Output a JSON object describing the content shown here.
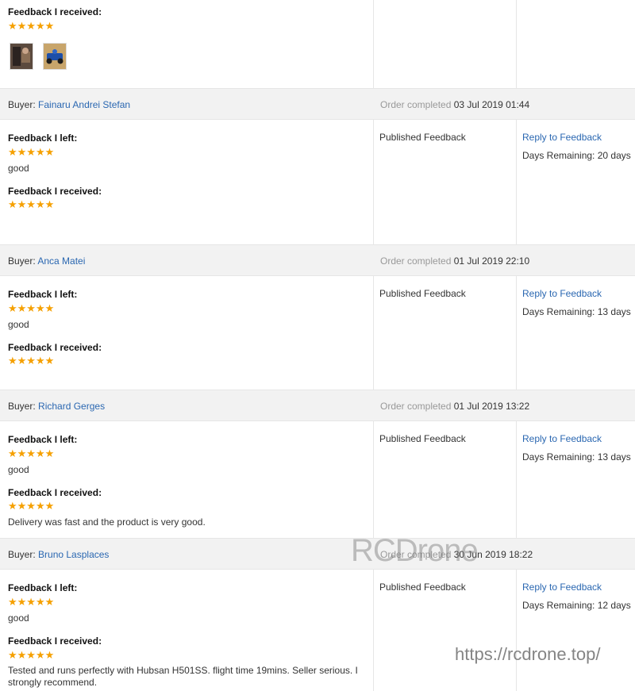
{
  "labels": {
    "feedback_left": "Feedback I left:",
    "feedback_received": "Feedback I received:",
    "buyer_prefix": "Buyer:",
    "order_completed": "Order completed",
    "published": "Published Feedback",
    "reply": "Reply to Feedback",
    "days_prefix": "Days Remaining:"
  },
  "stars_glyph": "★★★★★",
  "first_block": {
    "received_rating": 5,
    "photos": [
      "product-photo-icon",
      "product-photo-icon"
    ]
  },
  "orders": [
    {
      "buyer": "Fainaru Andrei Stefan",
      "completed": "03 Jul 2019 01:44",
      "left_rating": 5,
      "left_text": "good",
      "received_rating": 5,
      "received_text": "",
      "days_remaining": "20 days"
    },
    {
      "buyer": "Anca Matei",
      "completed": "01 Jul 2019 22:10",
      "left_rating": 5,
      "left_text": "good",
      "received_rating": 5,
      "received_text": "",
      "days_remaining": "13 days"
    },
    {
      "buyer": "Richard Gerges",
      "completed": "01 Jul 2019 13:22",
      "left_rating": 5,
      "left_text": "good",
      "received_rating": 5,
      "received_text": "Delivery was fast and the product is very good.",
      "days_remaining": "13 days"
    },
    {
      "buyer": "Bruno Lasplaces",
      "completed": "30 Jun 2019 18:22",
      "left_rating": 5,
      "left_text": "good",
      "received_rating": 5,
      "received_text": "Tested and runs perfectly with Hubsan H501SS. flight time 19mins. Seller serious. I strongly recommend.",
      "days_remaining": "12 days"
    }
  ],
  "watermark": {
    "brand": "RCDrone",
    "url": "https://rcdrone.top/"
  }
}
